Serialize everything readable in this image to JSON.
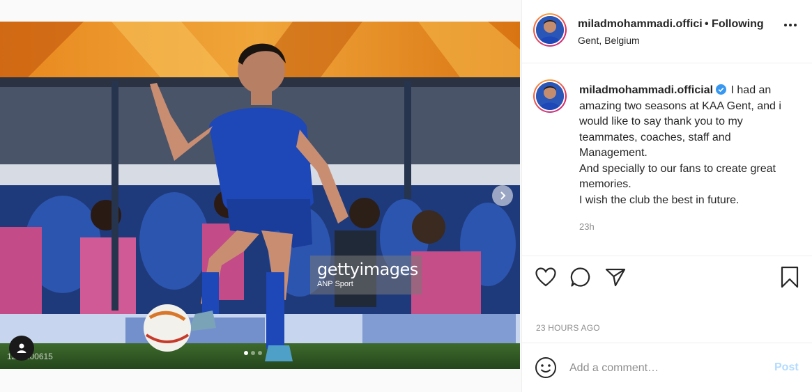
{
  "post": {
    "username": "miladmohammadi.official",
    "header_username": "miladmohammadi.offici",
    "follow_status": "• Following",
    "location": "Gent, Belgium",
    "caption": "I had an amazing two seasons at KAA Gent, and i would like to say thank you to my teammates, coaches, staff and Management.\nAnd specially to our fans to create great memories.\nI wish the club the best in future.",
    "caption_time": "23h",
    "timestamp": "23 HOURS AGO"
  },
  "media": {
    "watermark_brand": "gettyimages",
    "watermark_sub": "ANP Sport",
    "photo_id": "1231100615",
    "carousel_count": 3,
    "carousel_active": 1,
    "icons": [
      "next-arrow-icon",
      "user-tag-icon"
    ]
  },
  "actions": {
    "icons": [
      "heart-icon",
      "comment-icon",
      "share-icon",
      "bookmark-icon"
    ]
  },
  "comment": {
    "placeholder": "Add a comment…",
    "post_label": "Post",
    "emoji_icon": "emoji-icon"
  },
  "colors": {
    "verified": "#3897f0",
    "post_disabled": "#b3dbff",
    "muted": "#8e8e8e",
    "jersey": "#1e47b8"
  }
}
